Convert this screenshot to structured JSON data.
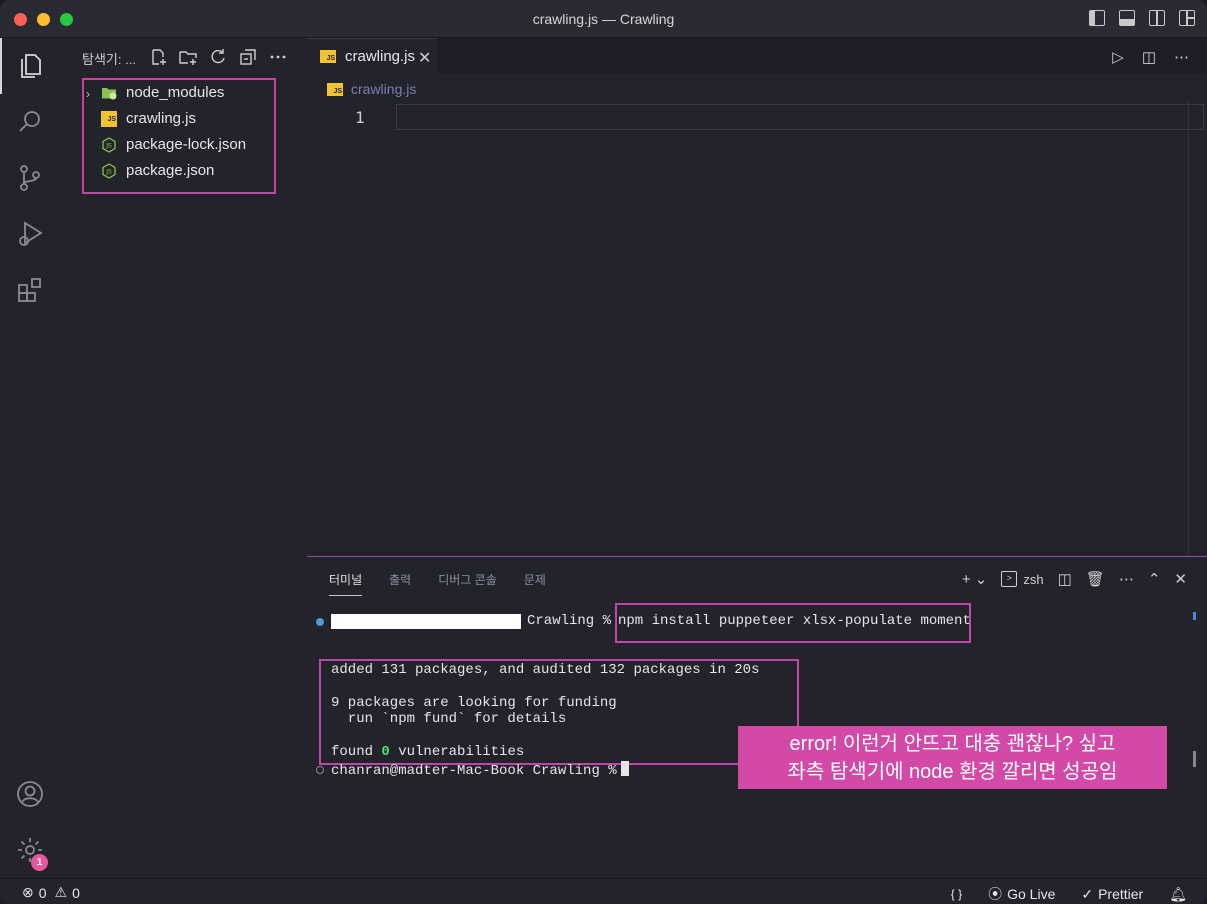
{
  "window": {
    "title": "crawling.js — Crawling"
  },
  "sidebar": {
    "header": "탐색기: ...",
    "files": [
      {
        "name": "node_modules",
        "type": "folder",
        "icon": "folder-node-icon"
      },
      {
        "name": "crawling.js",
        "type": "file",
        "icon": "js-file-icon"
      },
      {
        "name": "package-lock.json",
        "type": "file",
        "icon": "node-json-icon"
      },
      {
        "name": "package.json",
        "type": "file",
        "icon": "node-json-icon"
      }
    ]
  },
  "editor": {
    "tab_label": "crawling.js",
    "tab_icon_text": "JS",
    "breadcrumb": "crawling.js",
    "line_number": "1"
  },
  "panel": {
    "tabs": [
      "터미널",
      "출력",
      "디버그 콘솔",
      "문제"
    ],
    "active_tab": "터미널",
    "shell": "zsh",
    "terminal": {
      "prompt_dir": "Crawling %",
      "command": "npm install puppeteer xlsx-populate moment",
      "output_line1": "added 131 packages, and audited 132 packages in 20s",
      "output_line2": "9 packages are looking for funding",
      "output_line3": "  run `npm fund` for details",
      "output_found": "found ",
      "output_zero": "0",
      "output_vuln": " vulnerabilities",
      "final_prompt": "chanran@madter-Mac-Book Crawling %"
    }
  },
  "annotation": {
    "line1": "error! 이런거 안뜨고 대충 괜찮나? 싶고",
    "line2": "좌측 탐색기에 node 환경 깔리면 성공임"
  },
  "status": {
    "errors": "0",
    "warnings": "0",
    "braces": "{ }",
    "go_live": "Go Live",
    "prettier": "Prettier"
  },
  "activity": {
    "settings_badge": "1"
  },
  "colors": {
    "highlight": "#c046a8",
    "callout_bg": "#d349a8",
    "badge": "#e8569e"
  }
}
